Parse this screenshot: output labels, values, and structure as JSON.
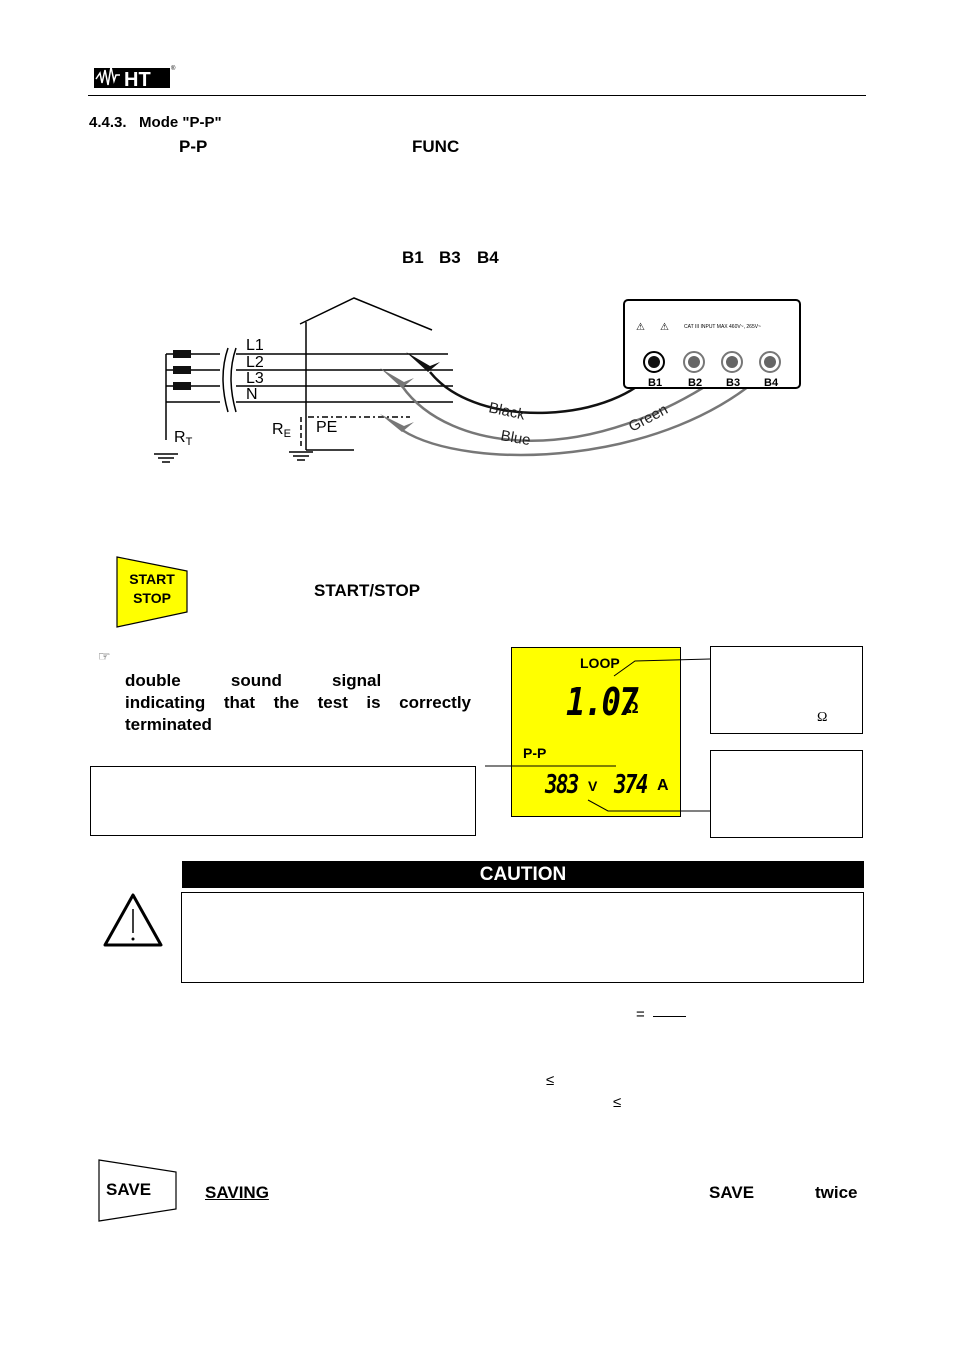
{
  "header": {
    "logo_text": "HT",
    "registered_mark": "®"
  },
  "section": {
    "title": "4.4.3.   Mode \"P-P\"",
    "intro_keyword_mode": "P-P",
    "intro_keyword_key": "FUNC",
    "terminals_text": [
      "B1",
      "B3",
      "B4"
    ]
  },
  "diagram": {
    "conductors": [
      "L1",
      "L2",
      "L3",
      "N"
    ],
    "pe_label": "PE",
    "rt_label": "R",
    "rt_sub": "T",
    "re_label": "R",
    "re_sub": "E",
    "lead_labels": [
      "Black",
      "Blue",
      "Green"
    ],
    "instrument_panel_text": "CAT III  INPUT MAX 460V~,  265V~",
    "instrument_terminals": [
      "B1",
      "B2",
      "B3",
      "B4"
    ],
    "colors": {
      "black_lead": "#111111",
      "gray_lead": "#777777"
    }
  },
  "start_stop": {
    "key_line1": "START",
    "key_line2": "STOP",
    "body_keyword": "START/STOP",
    "key_color": "#ffff00"
  },
  "note": {
    "icon": "pointing-hand-icon",
    "line1": "double   sound   signal",
    "rest": "indicating that the test is correctly terminated"
  },
  "lcd": {
    "background": "#ffff00",
    "mode_label": "LOOP",
    "main_value": "1.07",
    "main_unit": "Ω",
    "sub_mode_label": "P-P",
    "voltage_value": "383",
    "voltage_unit": "V",
    "current_value": "374",
    "current_unit": "A"
  },
  "callouts": {
    "loop_box_unit": "Ω"
  },
  "caution": {
    "title": "CAUTION"
  },
  "formula_symbols": {
    "equals": "=",
    "le1": "≤",
    "le2": "≤"
  },
  "saving": {
    "key_label": "SAVE",
    "heading": "SAVING",
    "key_ref": "SAVE",
    "twice": "twice"
  }
}
